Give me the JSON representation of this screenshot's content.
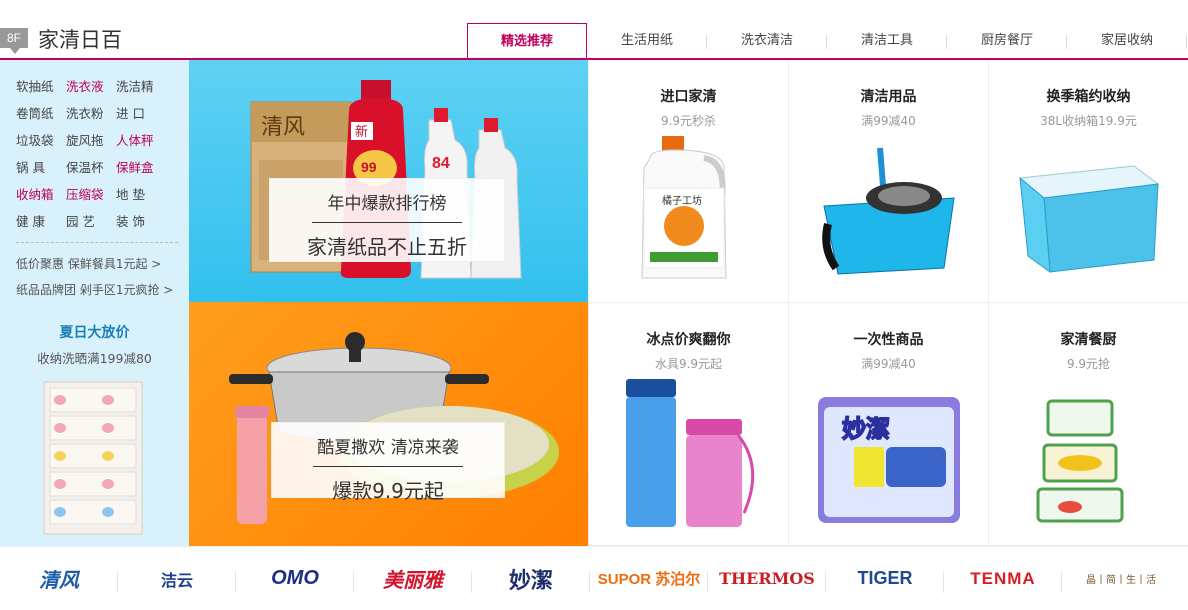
{
  "header": {
    "floor_tag": "8F",
    "title": "家清日百",
    "tabs": [
      {
        "label": "精选推荐",
        "active": true
      },
      {
        "label": "生活用纸"
      },
      {
        "label": "洗衣清洁"
      },
      {
        "label": "清洁工具"
      },
      {
        "label": "厨房餐厅"
      },
      {
        "label": "家居收纳"
      }
    ]
  },
  "categories": {
    "rows": [
      [
        "软抽纸",
        "洗衣液",
        "洗洁精"
      ],
      [
        "卷筒纸",
        "洗衣粉",
        "进 口"
      ],
      [
        "垃圾袋",
        "旋风拖",
        "人体秤"
      ],
      [
        "锅 具",
        "保温杯",
        "保鲜盒"
      ],
      [
        "收纳箱",
        "压缩袋",
        "地 垫"
      ],
      [
        "健 康",
        "园 艺",
        "装 饰"
      ]
    ],
    "promos": [
      "低价聚惠 保鲜餐具1元起 >",
      "纸品品牌团 剁手区1元疯抢 >"
    ]
  },
  "banner_top": {
    "line1": "年中爆款排行榜",
    "line2": "家清纸品不止五折",
    "product_text_1": "清风",
    "product_text_2": "新",
    "product_text_3": "84"
  },
  "banner_bottom": {
    "line1": "酷夏撒欢 清凉来袭",
    "line2": "爆款9.9元起"
  },
  "side_promo": {
    "title": "夏日大放价",
    "subtitle": "收纳洗晒满199减80"
  },
  "products": [
    {
      "title": "进口家清",
      "subtitle": "9.9元秒杀",
      "label": "橘子工坊"
    },
    {
      "title": "清洁用品",
      "subtitle": "满99减40"
    },
    {
      "title": "换季箱约收纳",
      "subtitle": "38L收纳箱19.9元"
    },
    {
      "title": "冰点价爽翻你",
      "subtitle": "水具9.9元起"
    },
    {
      "title": "一次性商品",
      "subtitle": "满99减40",
      "label": "妙潔"
    },
    {
      "title": "家清餐厨",
      "subtitle": "9.9元抢"
    }
  ],
  "brands": [
    "清风",
    "洁云",
    "OMO",
    "美丽雅",
    "妙潔",
    "SUPOR 苏泊尔",
    "THERMOS",
    "TIGER",
    "TENMA",
    "晶丨简丨生丨活"
  ],
  "colors": {
    "accent": "#c0005c",
    "panel_bg": "#d8f1fb",
    "banner_blue": "#3fc6f0",
    "banner_orange": "#ff8a00"
  }
}
